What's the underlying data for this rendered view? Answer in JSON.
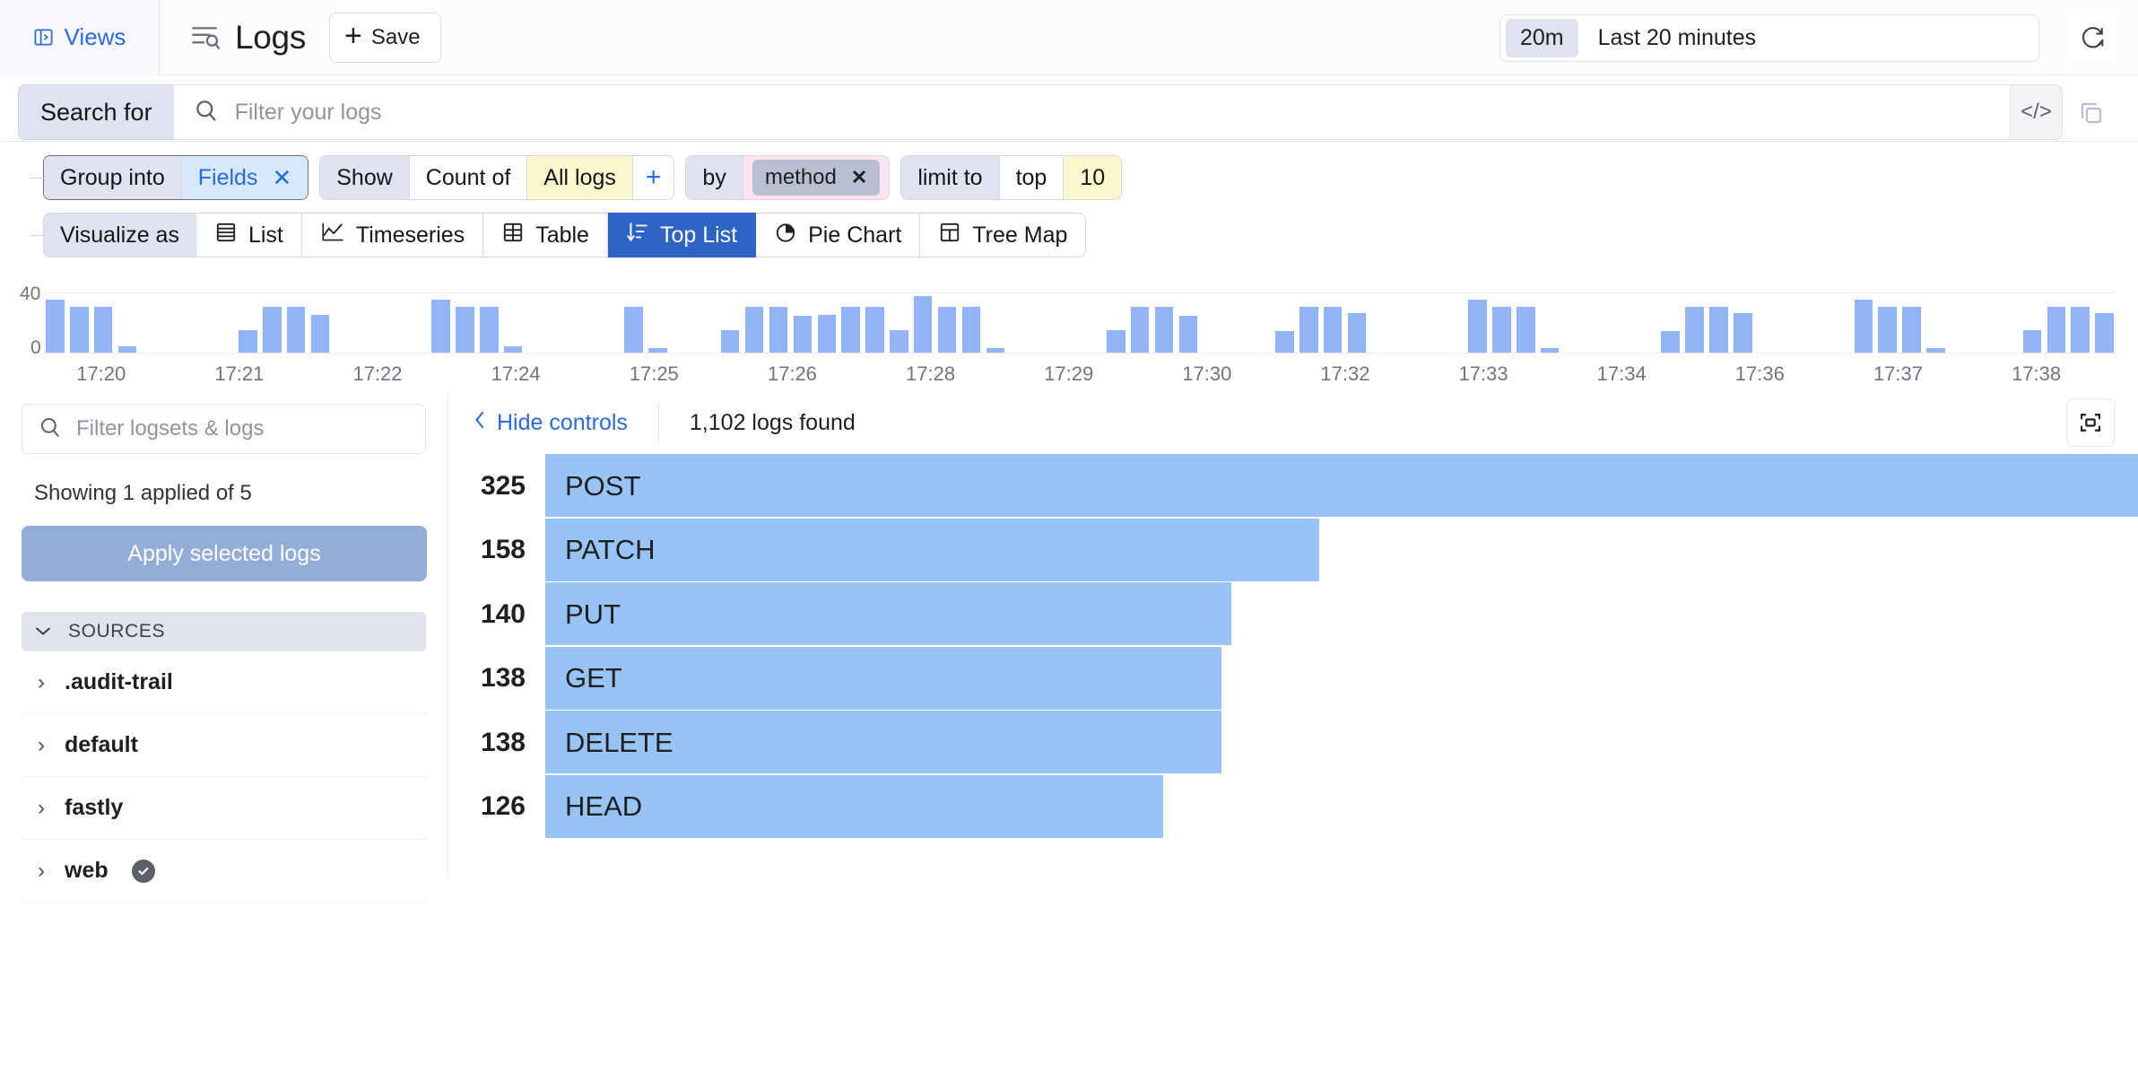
{
  "topbar": {
    "views_label": "Views",
    "title": "Logs",
    "save_label": "Save",
    "time_badge": "20m",
    "time_label": "Last 20 minutes"
  },
  "search": {
    "prefix_label": "Search for",
    "placeholder": "Filter your logs",
    "value": "",
    "code_label": "</>"
  },
  "query_builder": {
    "group": {
      "label": "Group into",
      "value": "Fields",
      "remove": "✕"
    },
    "show": {
      "label": "Show",
      "aggregation": "Count of",
      "target": "All logs",
      "add": "+"
    },
    "by": {
      "label": "by",
      "field": "method",
      "remove": "✕"
    },
    "limit": {
      "label": "limit to",
      "direction": "top",
      "count": "10"
    },
    "visualize": {
      "label": "Visualize as",
      "options": [
        {
          "label": "List",
          "icon": "list-icon",
          "active": false
        },
        {
          "label": "Timeseries",
          "icon": "timeseries-icon",
          "active": false
        },
        {
          "label": "Table",
          "icon": "table-icon",
          "active": false
        },
        {
          "label": "Top List",
          "icon": "top-list-icon",
          "active": true
        },
        {
          "label": "Pie Chart",
          "icon": "pie-chart-icon",
          "active": false
        },
        {
          "label": "Tree Map",
          "icon": "tree-map-icon",
          "active": false
        }
      ]
    }
  },
  "sidebar": {
    "filter_placeholder": "Filter logsets & logs",
    "filter_value": "",
    "showing": "Showing 1 applied of 5",
    "apply_label": "Apply selected logs",
    "sources_header": "SOURCES",
    "sources": [
      {
        "label": ".audit-trail",
        "selected": false
      },
      {
        "label": "default",
        "selected": false
      },
      {
        "label": "fastly",
        "selected": false
      },
      {
        "label": "web",
        "selected": true
      }
    ]
  },
  "controls": {
    "hide_controls": "Hide controls",
    "logs_found": "1,102 logs found"
  },
  "colors": {
    "accent": "#2a6ae0",
    "active_tab": "#2c63c4",
    "bar_fill": "#98c4f5",
    "histogram_bar": "#92b4f4",
    "chip_yellow": "#fcf7cd",
    "chip_pink": "#fbe4ee",
    "chip_blue": "#d7e8fb"
  },
  "chart_data": [
    {
      "type": "bar",
      "name": "top-list",
      "orientation": "horizontal",
      "title": "",
      "categories": [
        "POST",
        "PATCH",
        "PUT",
        "GET",
        "DELETE",
        "HEAD"
      ],
      "values": [
        325,
        158,
        140,
        138,
        138,
        126
      ],
      "xlabel": "",
      "ylabel": "",
      "legend": "none",
      "grid": false,
      "xlim": [
        0,
        325
      ]
    },
    {
      "type": "bar",
      "name": "timeline-histogram",
      "orientation": "vertical",
      "title": "",
      "xlabel": "",
      "ylabel": "",
      "ylim": [
        0,
        40
      ],
      "yticks": [
        0,
        40
      ],
      "grid": true,
      "xticks": [
        "17:20",
        "17:21",
        "17:22",
        "17:24",
        "17:25",
        "17:26",
        "17:28",
        "17:29",
        "17:30",
        "17:32",
        "17:33",
        "17:34",
        "17:36",
        "17:37",
        "17:38"
      ],
      "values": [
        35,
        30,
        30,
        4,
        0,
        0,
        0,
        0,
        15,
        30,
        30,
        25,
        0,
        0,
        0,
        0,
        35,
        30,
        30,
        4,
        0,
        0,
        0,
        0,
        30,
        3,
        0,
        0,
        15,
        30,
        30,
        24,
        25,
        30,
        30,
        15,
        37,
        30,
        30,
        3,
        0,
        0,
        0,
        0,
        15,
        30,
        30,
        24,
        0,
        0,
        0,
        14,
        30,
        30,
        26,
        0,
        0,
        0,
        0,
        35,
        30,
        30,
        3,
        0,
        0,
        0,
        0,
        14,
        30,
        30,
        26,
        0,
        0,
        0,
        0,
        35,
        30,
        30,
        3,
        0,
        0,
        0,
        15,
        30,
        30,
        26
      ]
    }
  ]
}
